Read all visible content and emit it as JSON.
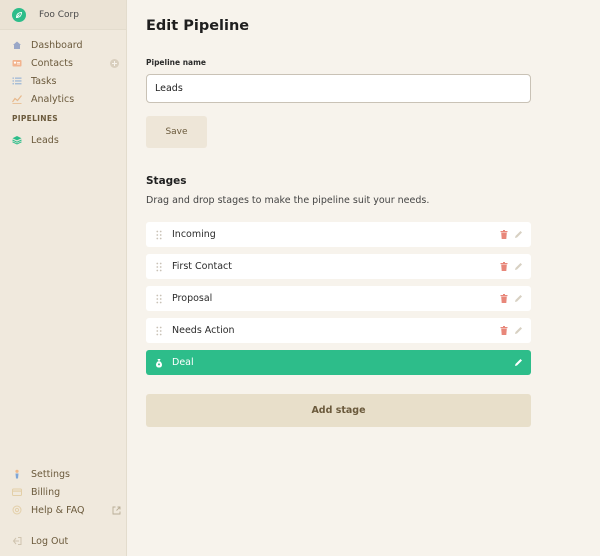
{
  "brand": {
    "name": "Foo Corp"
  },
  "sidebar": {
    "items": [
      {
        "label": "Dashboard",
        "icon": "home-icon"
      },
      {
        "label": "Contacts",
        "icon": "contacts-icon"
      },
      {
        "label": "Tasks",
        "icon": "list-icon"
      },
      {
        "label": "Analytics",
        "icon": "analytics-icon"
      }
    ],
    "section_title": "PIPELINES",
    "pipelines": [
      {
        "label": "Leads",
        "icon": "layers-icon"
      }
    ],
    "bottom_items": [
      {
        "label": "Settings",
        "icon": "settings-icon"
      },
      {
        "label": "Billing",
        "icon": "billing-icon"
      },
      {
        "label": "Help & FAQ",
        "icon": "help-icon"
      }
    ],
    "logout": {
      "label": "Log Out",
      "icon": "logout-icon"
    }
  },
  "main": {
    "title": "Edit Pipeline",
    "field_label": "Pipeline name",
    "pipeline_name": "Leads",
    "save_label": "Save",
    "stages_title": "Stages",
    "stages_desc": "Drag and drop stages to make the pipeline suit your needs.",
    "stages": [
      {
        "name": "Incoming"
      },
      {
        "name": "First Contact"
      },
      {
        "name": "Proposal"
      },
      {
        "name": "Needs Action"
      }
    ],
    "deal_stage": {
      "name": "Deal"
    },
    "add_stage_label": "Add stage"
  },
  "colors": {
    "accent": "#2dbd8a",
    "sidebar_bg": "#f0e9dd",
    "page_bg": "#f7f3ec",
    "delete": "#e8877a"
  }
}
